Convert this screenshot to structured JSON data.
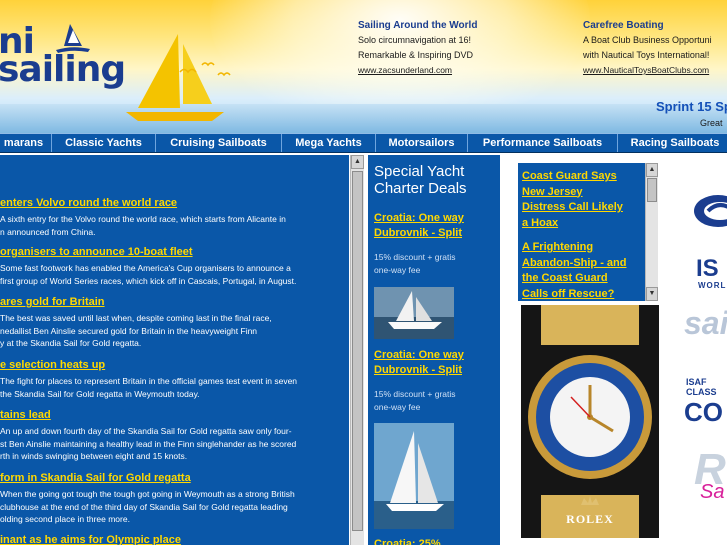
{
  "logo": {
    "line1": "ni",
    "line2": "sailing"
  },
  "header_ads": [
    {
      "title": "Sailing Around the World",
      "line1": "Solo circumnavigation at 16!",
      "line2": "Remarkable & Inspiring DVD",
      "url": "www.zacsunderland.com"
    },
    {
      "title": "Carefree Boating",
      "line1": "A Boat Club Business Opportuni",
      "line2": "with Nautical Toys International!",
      "url": "www.NauticalToysBoatClubs.com"
    }
  ],
  "promo": {
    "title": "Sprint 15 Sp",
    "subtitle": "Great"
  },
  "nav": [
    {
      "label": "marans"
    },
    {
      "label": "Classic Yachts"
    },
    {
      "label": "Cruising Sailboats"
    },
    {
      "label": "Mega Yachts"
    },
    {
      "label": "Motorsailors"
    },
    {
      "label": "Performance Sailboats"
    },
    {
      "label": "Racing Sailboats"
    }
  ],
  "news": [
    {
      "headline": "enters Volvo round the world race",
      "lines": [
        "A sixth entry for the Volvo round the world race, which starts from Alicante in",
        "n announced from China."
      ]
    },
    {
      "headline": "organisers to announce 10-boat fleet",
      "lines": [
        "Some fast footwork has enabled the America's Cup organisers to announce a",
        "first group of World Series races, which kick off in Cascais, Portugal, in August."
      ]
    },
    {
      "headline": "ares gold for Britain",
      "lines": [
        "The best was saved until last when, despite coming last in the final race,",
        "nedallist Ben Ainslie secured gold for Britain in the heavyweight Finn",
        "y at the Skandia Sail for Gold regatta."
      ]
    },
    {
      "headline": "e selection heats up",
      "lines": [
        "The fight for places to represent Britain in the official games test event in seven",
        "the Skandia Sail for Gold regatta in Weymouth today."
      ]
    },
    {
      "headline": "tains lead",
      "lines": [
        "An up and down fourth day of the Skandia Sail for Gold regatta saw only four-",
        "st Ben Ainslie maintaining a healthy lead in the Finn singlehander as he scored",
        "rth in winds swinging between eight and 15 knots."
      ]
    },
    {
      "headline": "form in Skandia Sail for Gold regatta",
      "lines": [
        "When the going got tough the tough got going in Weymouth as a strong British",
        "clubhouse at the end of the third day of Skandia Sail for Gold regatta leading",
        "olding second place in three more."
      ]
    },
    {
      "headline": "inant as he aims for Olympic place",
      "lines": []
    }
  ],
  "deals": {
    "title": "Special Yacht Charter Deals",
    "items": [
      {
        "line1": "Croatia: One way",
        "line2": "Dubrovnik - Split",
        "text1": "15% discount + gratis",
        "text2": "one-way fee"
      },
      {
        "line1": "Croatia: One way",
        "line2": "Dubrovnik - Split",
        "text1": "15% discount + gratis",
        "text2": "one-way fee"
      },
      {
        "line1": "Croatia: 25%",
        "line2": "",
        "text1": "",
        "text2": ""
      }
    ]
  },
  "coast_guard": [
    "Coast Guard Says",
    "New Jersey",
    "Distress Call Likely",
    "a Hoax",
    "A Frightening",
    "Abandon-Ship - and",
    "the Coast Guard",
    "Calls off Rescue?"
  ],
  "watch_ad": {
    "brand": "ROLEX"
  },
  "sponsor_logos": {
    "isaf": "IS",
    "world": "WORLD",
    "sail": "sai",
    "isaf_class_line1": "ISAF",
    "isaf_class_line2": "CLASS",
    "isaf_class_line3": "CO",
    "rs": "R",
    "rs_script": "Sa"
  },
  "colors": {
    "panel_blue": "#0a57a8",
    "link_yellow": "#ffd800",
    "brand_navy": "#1b3d8f"
  }
}
